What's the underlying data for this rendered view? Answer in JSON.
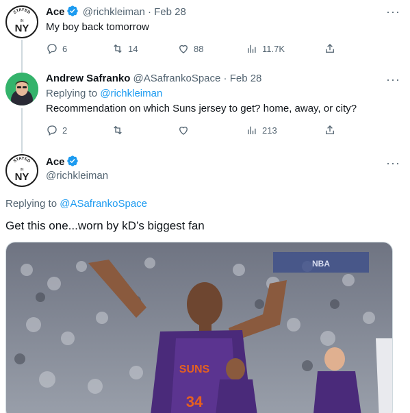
{
  "colors": {
    "accent": "#1d9bf0",
    "muted": "#536471",
    "suns_purple": "#4a2a7a",
    "suns_orange": "#e56020"
  },
  "tweets": [
    {
      "name": "Ace",
      "handle": "@richkleiman",
      "sep": "·",
      "date": "Feb 28",
      "verified": true,
      "text": "My boy back tomorrow",
      "counts": {
        "reply": "6",
        "retweet": "14",
        "like": "88",
        "views": "11.7K"
      },
      "avatar_text": {
        "top": "STAYED",
        "mid": "IN",
        "main": "NY"
      }
    },
    {
      "name": "Andrew Safranko",
      "handle": "@ASafrankoSpace",
      "sep": "·",
      "date": "Feb 28",
      "reply_prefix": "Replying to",
      "reply_target": "@richkleiman",
      "text": "Recommendation on which Suns jersey to get? home, away, or city?",
      "counts": {
        "reply": "2",
        "retweet": "",
        "like": "",
        "views": "213"
      }
    }
  ],
  "main_tweet": {
    "name": "Ace",
    "handle": "@richkleiman",
    "verified": true,
    "reply_prefix": "Replying to",
    "reply_target": "@ASafrankoSpace",
    "text": "Get this one...worn by kD’s biggest fan",
    "avatar_text": {
      "top": "STAYED",
      "mid": "IN",
      "main": "NY"
    },
    "media": {
      "jersey_text": "SUNS",
      "number": "34",
      "banner_text": "NBA"
    }
  },
  "icons": [
    "more-icon",
    "reply-icon",
    "retweet-icon",
    "like-icon",
    "views-icon",
    "share-icon",
    "verified-icon"
  ]
}
